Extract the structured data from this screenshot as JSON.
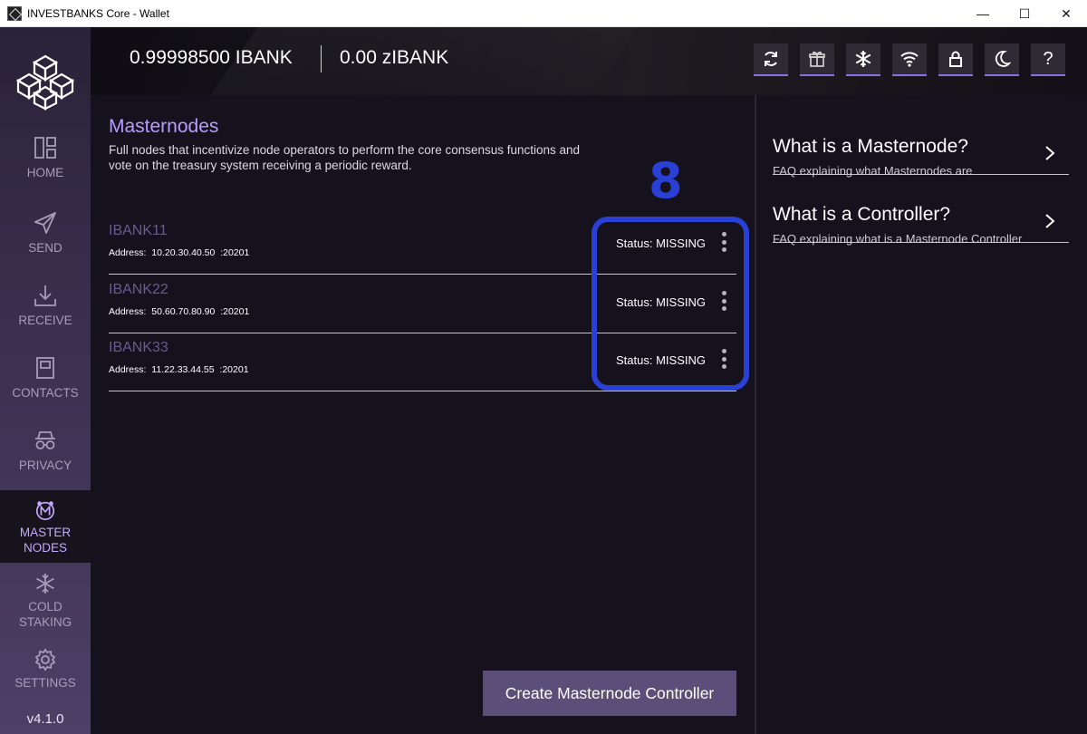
{
  "window": {
    "title": "INVESTBANKS Core - Wallet",
    "minimize_glyph": "—",
    "maximize_glyph": "☐",
    "close_glyph": "✕"
  },
  "sidebar": {
    "items": [
      {
        "label": "HOME",
        "icon": "home-icon"
      },
      {
        "label": "SEND",
        "icon": "send-icon"
      },
      {
        "label": "RECEIVE",
        "icon": "receive-icon"
      },
      {
        "label": "CONTACTS",
        "icon": "contacts-icon"
      },
      {
        "label": "PRIVACY",
        "icon": "privacy-icon"
      },
      {
        "label_line1": "MASTER",
        "label_line2": "NODES",
        "icon": "masternodes-icon",
        "active": true
      },
      {
        "label_line1": "COLD",
        "label_line2": "STAKING",
        "icon": "snowflake-icon"
      },
      {
        "label": "SETTINGS",
        "icon": "gear-icon"
      }
    ],
    "version": "v4.1.0"
  },
  "header": {
    "balance_ibank": "0.99998500 IBANK",
    "balance_zibank": "0.00 zIBANK",
    "icons": [
      "sync-icon",
      "gift-icon",
      "snowflake-icon",
      "wifi-icon",
      "lock-icon",
      "moon-icon",
      "help-icon"
    ]
  },
  "main": {
    "title": "Masternodes",
    "description": "Full nodes that incentivize node operators to perform the core consensus functions and vote on the treasury system receiving a periodic reward.",
    "annotation": "8",
    "nodes": [
      {
        "name": "IBANK11",
        "address_label": "Address:",
        "address": "10.20.30.40.50",
        "port": ":20201",
        "status": "Status: MISSING"
      },
      {
        "name": "IBANK22",
        "address_label": "Address:",
        "address": "50.60.70.80.90",
        "port": ":20201",
        "status": "Status: MISSING"
      },
      {
        "name": "IBANK33",
        "address_label": "Address:",
        "address": "11.22.33.44.55",
        "port": ":20201",
        "status": "Status: MISSING"
      }
    ],
    "create_button": "Create Masternode Controller"
  },
  "faq": [
    {
      "title": "What is a Masternode?",
      "subtitle": "FAQ explaining what Masternodes are"
    },
    {
      "title": "What is a Controller?",
      "subtitle": "FAQ explaining what is a Masternode Controller"
    }
  ],
  "colors": {
    "accent": "#b89cff",
    "annotation": "#2a3fd4",
    "button": "#5b4e78"
  }
}
